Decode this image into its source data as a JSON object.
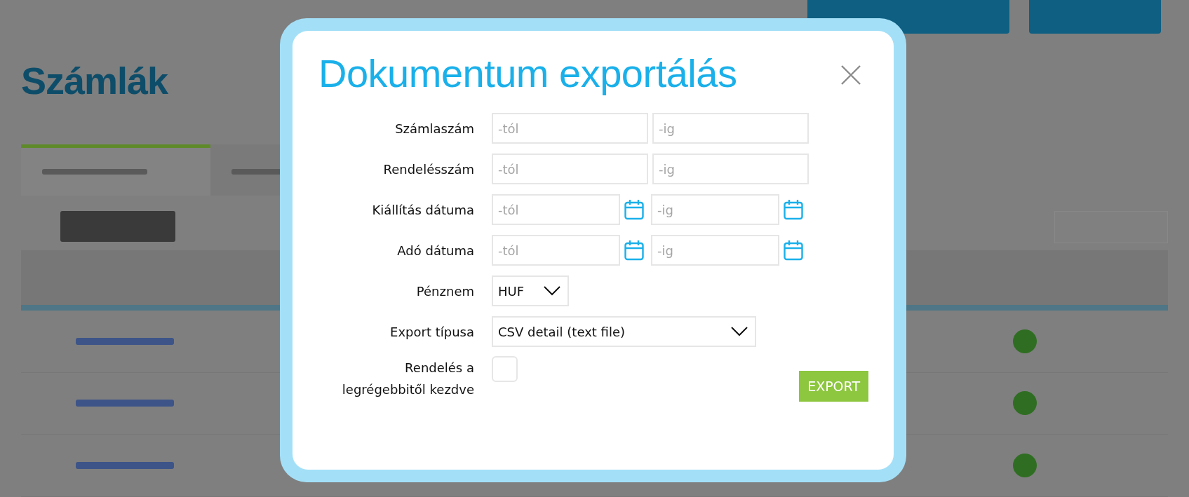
{
  "background": {
    "title": "Számlák",
    "tabs": [
      {
        "selected": true
      },
      {
        "selected": false
      }
    ],
    "rows": [
      {
        "color": "#2f6e22"
      },
      {
        "color": "#2f6e22"
      },
      {
        "color": "#2f6e22"
      }
    ]
  },
  "dialog": {
    "title": "Dokumentum exportálás",
    "fields": [
      {
        "kind": "range",
        "label": "Számlaszám",
        "from_placeholder": "-tól",
        "to_placeholder": "-ig"
      },
      {
        "kind": "range",
        "label": "Rendelésszám",
        "from_placeholder": "-tól",
        "to_placeholder": "-ig"
      },
      {
        "kind": "date_range",
        "label": "Kiállítás dátuma",
        "from_placeholder": "-tól",
        "to_placeholder": "-ig"
      },
      {
        "kind": "date_range",
        "label": "Adó dátuma",
        "from_placeholder": "-tól",
        "to_placeholder": "-ig"
      },
      {
        "kind": "select",
        "label": "Pénznem",
        "value": "HUF"
      },
      {
        "kind": "wide_select",
        "label": "Export típusa",
        "value": "CSV detail (text file)"
      },
      {
        "kind": "checkbox",
        "label": "Rendelés a legrégebbitől kezdve",
        "checked": false
      }
    ],
    "button": "EXPORT"
  }
}
